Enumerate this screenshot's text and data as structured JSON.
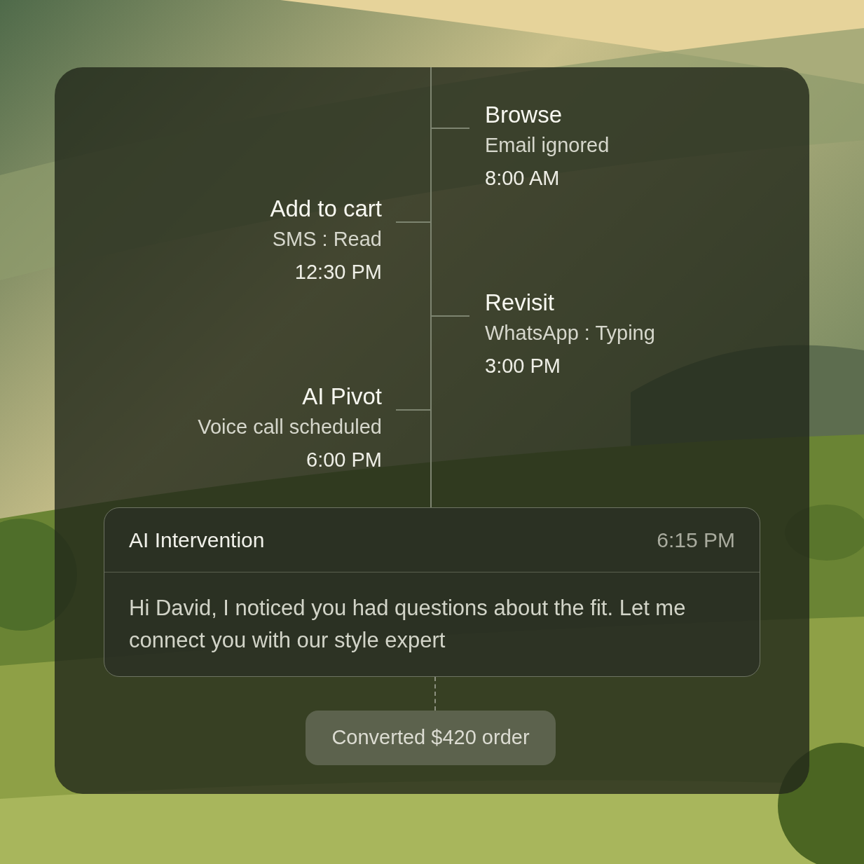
{
  "timeline": [
    {
      "kind": "right",
      "title": "Browse",
      "detail": "Email ignored",
      "time": "8:00 AM"
    },
    {
      "kind": "left",
      "title": "Add to cart",
      "detail": "SMS : Read",
      "time": "12:30 PM"
    },
    {
      "kind": "right",
      "title": "Revisit",
      "detail": "WhatsApp : Typing",
      "time": "3:00 PM"
    },
    {
      "kind": "left",
      "title": "AI Pivot",
      "detail": "Voice call scheduled",
      "time": "6:00 PM"
    }
  ],
  "intervention": {
    "title": "AI Intervention",
    "time": "6:15 PM",
    "message": "Hi David, I noticed you had questions  about the fit. Let me connect you with our style expert"
  },
  "result": {
    "label": "Converted $420 order"
  }
}
